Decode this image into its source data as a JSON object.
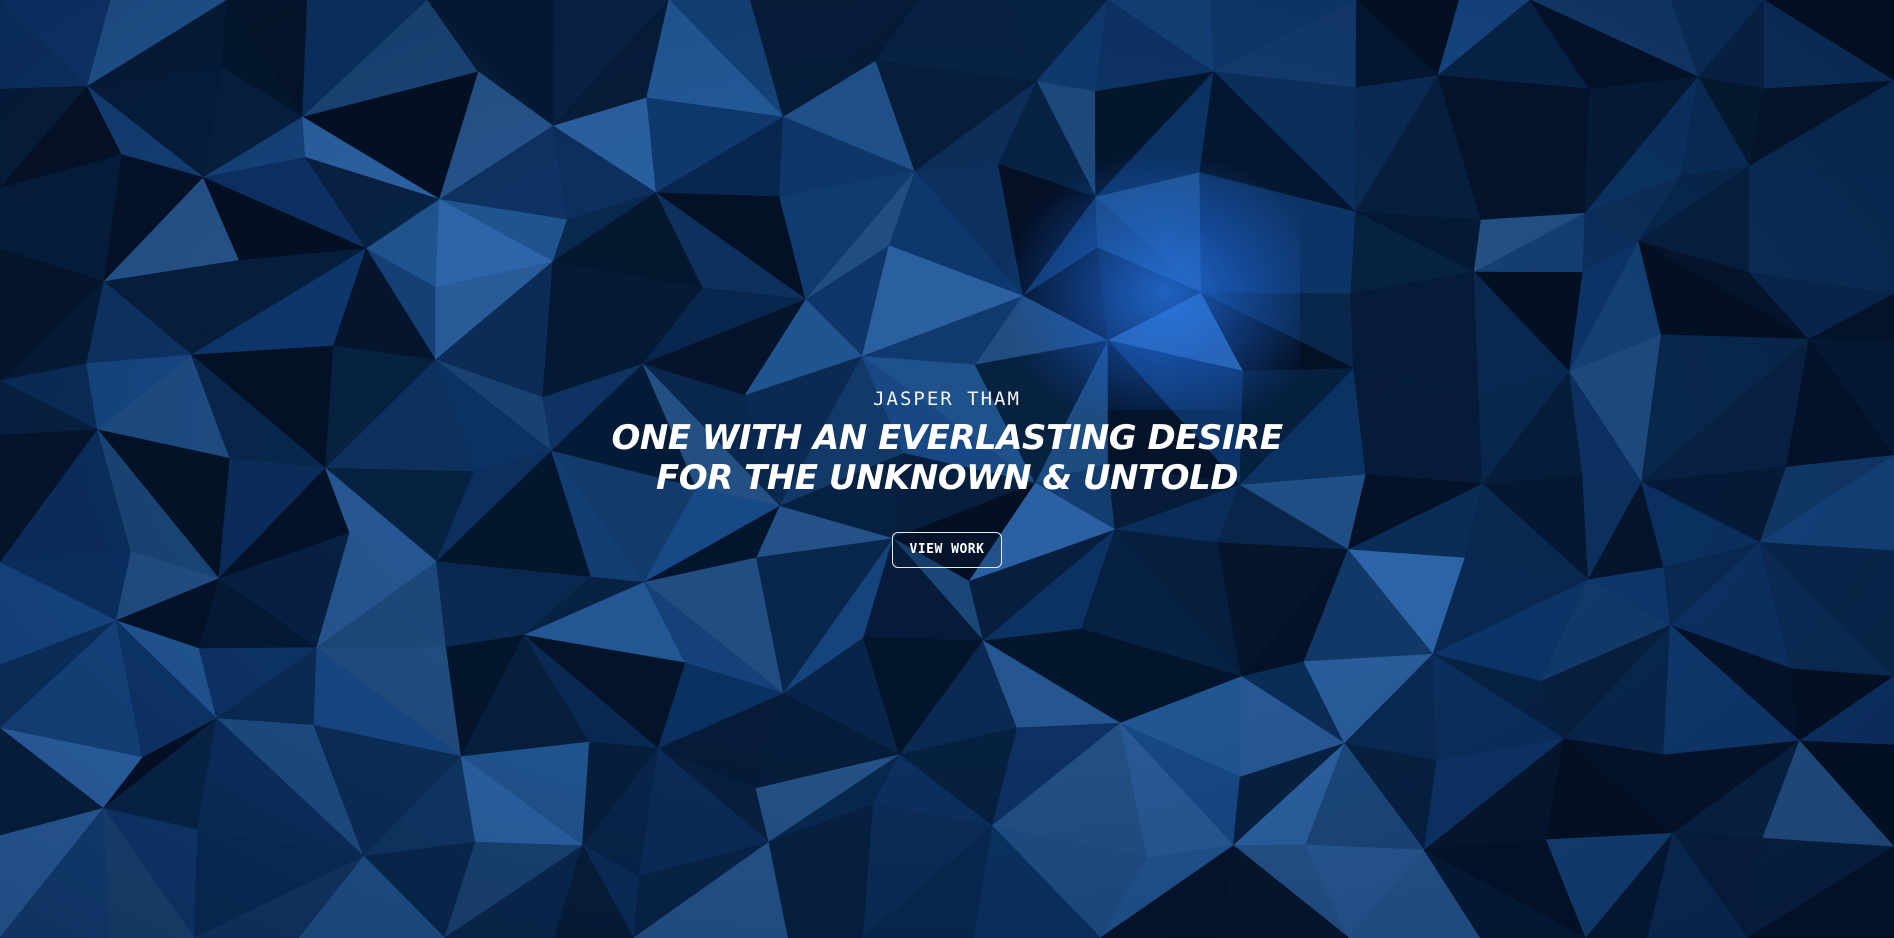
{
  "hero": {
    "name": "JASPER THAM",
    "title_line1": "ONE WITH AN EVERLASTING DESIRE",
    "title_line2": "FOR THE UNKNOWN & UNTOLD",
    "cta_label": "VIEW WORK"
  },
  "theme": {
    "background": "#062448",
    "accent_glow": "#1f6fdc",
    "text": "#ffffff"
  }
}
